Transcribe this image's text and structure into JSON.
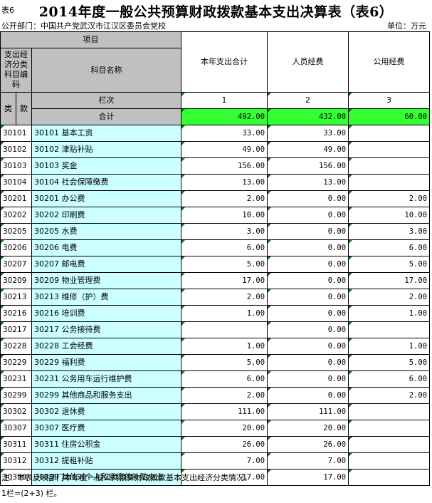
{
  "header": {
    "tag": "表6",
    "title": "2014年度一般公共预算财政拨款基本支出决算表（表6）",
    "dept": "公开部门：中国共产党武汉市江汉区委员会党校",
    "unit": "单位：万元"
  },
  "table": {
    "item_header": "项目",
    "code_header": "支出经济分类科目编码",
    "name_header": "科目名称",
    "lei": "类",
    "kuan": "款",
    "col_total": "本年支出合计",
    "col_personnel": "人员经费",
    "col_public": "公用经费",
    "lanci": "栏次",
    "col_no_1": "1",
    "col_no_2": "2",
    "col_no_3": "3",
    "sum_label": "合计",
    "sum_total": "492.00",
    "sum_personnel": "432.00",
    "sum_public": "60.00",
    "rows": [
      {
        "code": "30101",
        "name": "30101 基本工资",
        "total": "33.00",
        "personnel": "33.00",
        "public": ""
      },
      {
        "code": "30102",
        "name": "30102 津贴补贴",
        "total": "49.00",
        "personnel": "49.00",
        "public": ""
      },
      {
        "code": "30103",
        "name": "30103 奖金",
        "total": "156.00",
        "personnel": "156.00",
        "public": ""
      },
      {
        "code": "30104",
        "name": "30104 社会保障缴费",
        "total": "13.00",
        "personnel": "13.00",
        "public": ""
      },
      {
        "code": "30201",
        "name": "30201 办公费",
        "total": "2.00",
        "personnel": "0.00",
        "public": "2.00"
      },
      {
        "code": "30202",
        "name": "30202 印刷费",
        "total": "10.00",
        "personnel": "0.00",
        "public": "10.00"
      },
      {
        "code": "30205",
        "name": "30205 水费",
        "total": "3.00",
        "personnel": "0.00",
        "public": "3.00"
      },
      {
        "code": "30206",
        "name": "30206 电费",
        "total": "6.00",
        "personnel": "0.00",
        "public": "6.00"
      },
      {
        "code": "30207",
        "name": "30207 邮电费",
        "total": "5.00",
        "personnel": "0.00",
        "public": "5.00"
      },
      {
        "code": "30209",
        "name": "30209 物业管理费",
        "total": "17.00",
        "personnel": "0.00",
        "public": "17.00"
      },
      {
        "code": "30213",
        "name": "30213 维修（护）费",
        "total": "2.00",
        "personnel": "0.00",
        "public": "2.00"
      },
      {
        "code": "30216",
        "name": "30216 培训费",
        "total": "1.00",
        "personnel": "0.00",
        "public": "1.00"
      },
      {
        "code": "30217",
        "name": "30217 公务接待费",
        "total": "",
        "personnel": "0.00",
        "public": ""
      },
      {
        "code": "30228",
        "name": "30228 工会经费",
        "total": "1.00",
        "personnel": "0.00",
        "public": "1.00"
      },
      {
        "code": "30229",
        "name": "30229 福利费",
        "total": "5.00",
        "personnel": "0.00",
        "public": "5.00"
      },
      {
        "code": "30231",
        "name": "30231 公务用车运行维护费",
        "total": "6.00",
        "personnel": "0.00",
        "public": "6.00"
      },
      {
        "code": "30299",
        "name": "30299 其他商品和服务支出",
        "total": "2.00",
        "personnel": "0.00",
        "public": "2.00"
      },
      {
        "code": "30302",
        "name": "30302 退休费",
        "total": "111.00",
        "personnel": "111.00",
        "public": ""
      },
      {
        "code": "30307",
        "name": "30307 医疗费",
        "total": "20.00",
        "personnel": "20.00",
        "public": ""
      },
      {
        "code": "30311",
        "name": "30311 住房公积金",
        "total": "26.00",
        "personnel": "26.00",
        "public": ""
      },
      {
        "code": "30312",
        "name": "30312 提租补贴",
        "total": "7.00",
        "personnel": "7.00",
        "public": ""
      },
      {
        "code": "30399",
        "name": "30399 其他对个人和家庭的补助支出",
        "total": "17.00",
        "personnel": "17.00",
        "public": ""
      }
    ]
  },
  "notes": {
    "line1": "注：本表反映部门本年度一般公共预算财政拨款基本支出经济分类情况。",
    "line2": "1栏=(2+3) 栏。"
  },
  "colors": {
    "gray_header": "#c0c0c0",
    "cyan_cell": "#ccffff",
    "green_total": "#33ff33"
  }
}
